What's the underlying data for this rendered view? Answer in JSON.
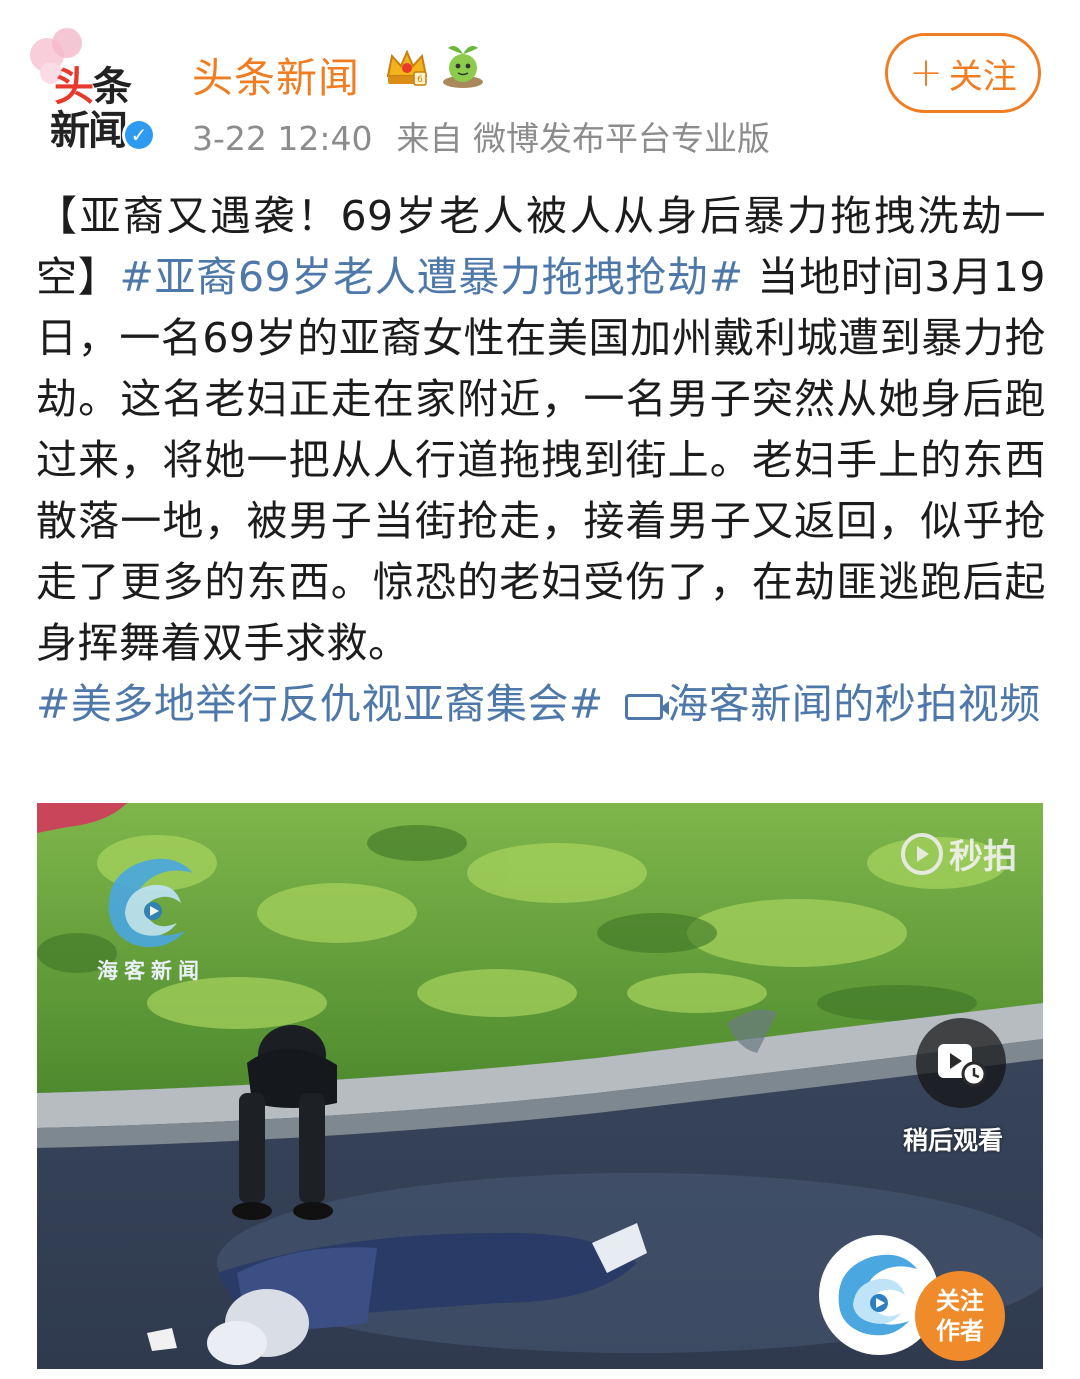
{
  "header": {
    "avatar_logo": "头条新闻",
    "username": "头条新闻",
    "timestamp": "3-22 12:40",
    "source": "来自 微博发布平台专业版",
    "follow_label": "关注",
    "follow_plus": "+"
  },
  "post": {
    "title": "【亚裔又遇袭！69岁老人被人从身后暴力拖拽洗劫一空】",
    "hashtag1": "#亚裔69岁老人遭暴力拖拽抢劫#",
    "body": "当地时间3月19日，一名69岁的亚裔女性在美国加州戴利城遭到暴力抢劫。这名老妇正走在家附近，一名男子突然从她身后跑过来，将她一把从人行道拖拽到街上。老妇手上的东西散落一地，被男子当街抢走，接着男子又返回，似乎抢走了更多的东西。惊恐的老妇受伤了，在劫匪逃跑后起身挥舞着双手求救。",
    "hashtag2": "#美多地举行反仇视亚裔集会#",
    "video_link": "海客新闻的秒拍视频"
  },
  "video": {
    "watermark_left": "海客新闻",
    "watermark_right": "秒拍",
    "watch_later": "稍后观看",
    "follow_author": [
      "关注",
      "作者"
    ]
  },
  "colors": {
    "brand_orange": "#f07d22",
    "hashtag_blue": "#4d78a9",
    "meta_gray": "#8c8c8c",
    "verified_blue": "#2f9bf0"
  },
  "icons": [
    "verified-icon",
    "crown-badge-icon",
    "sprout-badge-icon",
    "link-video-icon",
    "miaopai-icon",
    "watch-later-icon"
  ]
}
